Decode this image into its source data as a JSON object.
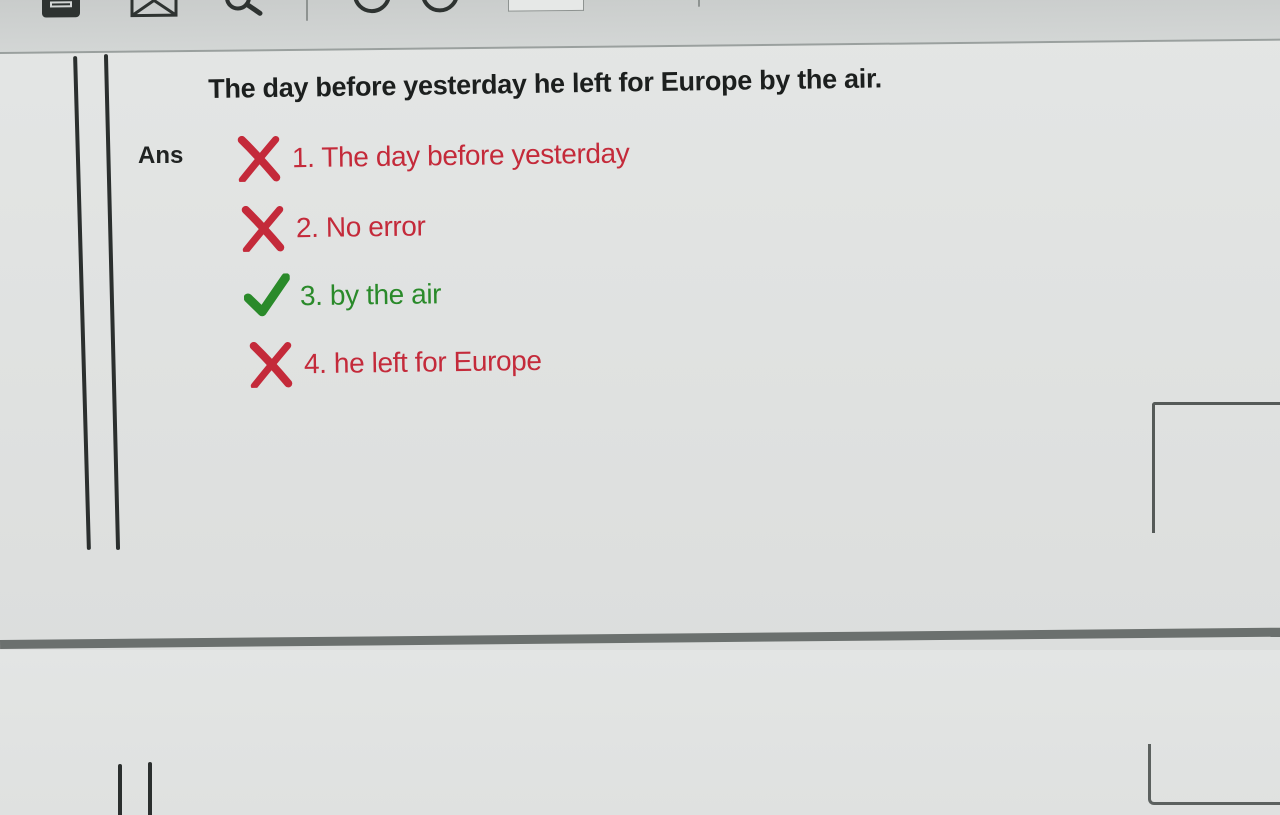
{
  "question": {
    "text": "The day before yesterday he left for Europe by the air."
  },
  "answer": {
    "label": "Ans",
    "options": [
      {
        "text": "1. The day before yesterday",
        "status": "wrong",
        "icon": "cross-icon"
      },
      {
        "text": "2. No error",
        "status": "wrong",
        "icon": "cross-icon"
      },
      {
        "text": "3. by the air",
        "status": "correct",
        "icon": "check-icon"
      },
      {
        "text": "4. he left for Europe",
        "status": "wrong",
        "icon": "cross-icon"
      }
    ]
  },
  "toolbar": {
    "icons": [
      "print-icon",
      "mail-icon",
      "search-icon",
      "circle-button-icon",
      "circle-button-icon"
    ]
  },
  "colors": {
    "wrong": "#c42a3a",
    "correct": "#2a8a2a",
    "text": "#1c1f1e"
  }
}
